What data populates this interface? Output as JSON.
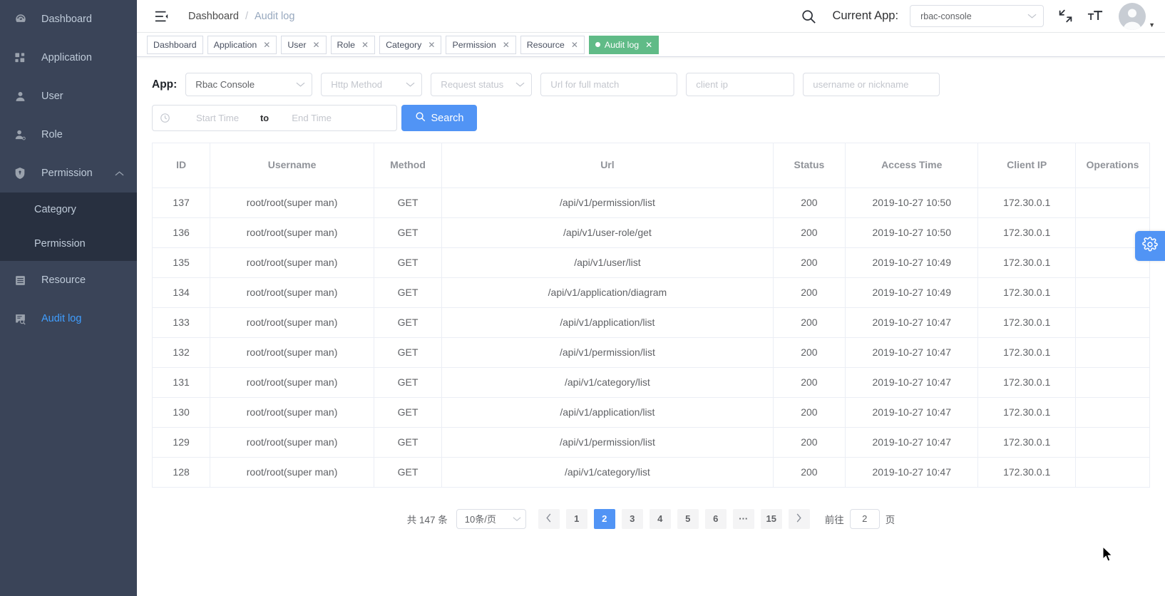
{
  "sidebar": {
    "items": [
      {
        "label": "Dashboard",
        "icon": "dashboard-icon",
        "active": false
      },
      {
        "label": "Application",
        "icon": "grid-icon",
        "active": false
      },
      {
        "label": "User",
        "icon": "user-icon",
        "active": false
      },
      {
        "label": "Role",
        "icon": "role-icon",
        "active": false
      },
      {
        "label": "Permission",
        "icon": "shield-icon",
        "active": false,
        "expanded": true,
        "children": [
          {
            "label": "Category"
          },
          {
            "label": "Permission"
          }
        ]
      },
      {
        "label": "Resource",
        "icon": "list-icon",
        "active": false
      },
      {
        "label": "Audit log",
        "icon": "audit-icon",
        "active": true
      }
    ]
  },
  "navbar": {
    "hamburger_icon": "hamburger-icon",
    "breadcrumb": {
      "root": "Dashboard",
      "separator": "/",
      "current": "Audit log"
    },
    "search_icon": "search-icon",
    "current_app_label": "Current App:",
    "app_select_value": "rbac-console",
    "fullscreen_icon": "fullscreen-icon",
    "fontsize_icon": "font-size-icon",
    "avatar_icon": "avatar-icon",
    "caret_icon": "caret-down-icon"
  },
  "tags": [
    {
      "label": "Dashboard",
      "closable": false,
      "active": false
    },
    {
      "label": "Application",
      "closable": true,
      "active": false
    },
    {
      "label": "User",
      "closable": true,
      "active": false
    },
    {
      "label": "Role",
      "closable": true,
      "active": false
    },
    {
      "label": "Category",
      "closable": true,
      "active": false
    },
    {
      "label": "Permission",
      "closable": true,
      "active": false
    },
    {
      "label": "Resource",
      "closable": true,
      "active": false
    },
    {
      "label": "Audit log",
      "closable": true,
      "active": true
    }
  ],
  "filters": {
    "app_label": "App:",
    "app_value": "Rbac Console",
    "http_method_placeholder": "Http Method",
    "request_status_placeholder": "Request status",
    "url_placeholder": "Url for full match",
    "client_ip_placeholder": "client ip",
    "username_placeholder": "username or nickname",
    "start_time_placeholder": "Start Time",
    "to_label": "to",
    "end_time_placeholder": "End Time",
    "search_button": "Search",
    "clock_icon": "clock-icon",
    "search_icon": "search-icon"
  },
  "table": {
    "columns": [
      "ID",
      "Username",
      "Method",
      "Url",
      "Status",
      "Access Time",
      "Client IP",
      "Operations"
    ],
    "rows": [
      {
        "id": "137",
        "username": "root/root(super man)",
        "method": "GET",
        "url": "/api/v1/permission/list",
        "status": "200",
        "access_time": "2019-10-27 10:50",
        "client_ip": "172.30.0.1",
        "operations": ""
      },
      {
        "id": "136",
        "username": "root/root(super man)",
        "method": "GET",
        "url": "/api/v1/user-role/get",
        "status": "200",
        "access_time": "2019-10-27 10:50",
        "client_ip": "172.30.0.1",
        "operations": ""
      },
      {
        "id": "135",
        "username": "root/root(super man)",
        "method": "GET",
        "url": "/api/v1/user/list",
        "status": "200",
        "access_time": "2019-10-27 10:49",
        "client_ip": "172.30.0.1",
        "operations": ""
      },
      {
        "id": "134",
        "username": "root/root(super man)",
        "method": "GET",
        "url": "/api/v1/application/diagram",
        "status": "200",
        "access_time": "2019-10-27 10:49",
        "client_ip": "172.30.0.1",
        "operations": ""
      },
      {
        "id": "133",
        "username": "root/root(super man)",
        "method": "GET",
        "url": "/api/v1/application/list",
        "status": "200",
        "access_time": "2019-10-27 10:47",
        "client_ip": "172.30.0.1",
        "operations": ""
      },
      {
        "id": "132",
        "username": "root/root(super man)",
        "method": "GET",
        "url": "/api/v1/permission/list",
        "status": "200",
        "access_time": "2019-10-27 10:47",
        "client_ip": "172.30.0.1",
        "operations": ""
      },
      {
        "id": "131",
        "username": "root/root(super man)",
        "method": "GET",
        "url": "/api/v1/category/list",
        "status": "200",
        "access_time": "2019-10-27 10:47",
        "client_ip": "172.30.0.1",
        "operations": ""
      },
      {
        "id": "130",
        "username": "root/root(super man)",
        "method": "GET",
        "url": "/api/v1/application/list",
        "status": "200",
        "access_time": "2019-10-27 10:47",
        "client_ip": "172.30.0.1",
        "operations": ""
      },
      {
        "id": "129",
        "username": "root/root(super man)",
        "method": "GET",
        "url": "/api/v1/permission/list",
        "status": "200",
        "access_time": "2019-10-27 10:47",
        "client_ip": "172.30.0.1",
        "operations": ""
      },
      {
        "id": "128",
        "username": "root/root(super man)",
        "method": "GET",
        "url": "/api/v1/category/list",
        "status": "200",
        "access_time": "2019-10-27 10:47",
        "client_ip": "172.30.0.1",
        "operations": ""
      }
    ]
  },
  "pagination": {
    "total_text": "共 147 条",
    "page_size": "10条/页",
    "prev_icon": "chevron-left-icon",
    "next_icon": "chevron-right-icon",
    "pages": [
      "1",
      "2",
      "3",
      "4",
      "5",
      "6",
      "···",
      "15"
    ],
    "current_page": "2",
    "jump_prefix": "前往",
    "jump_value": "2",
    "jump_suffix": "页"
  },
  "settings_handle": {
    "icon": "gear-icon"
  },
  "colors": {
    "sidebar_bg": "#3a4458",
    "submenu_bg": "#283040",
    "accent_blue": "#409eff",
    "primary_button": "#5194f5",
    "active_tag_green": "#60bb87",
    "border": "#ebeef5"
  }
}
